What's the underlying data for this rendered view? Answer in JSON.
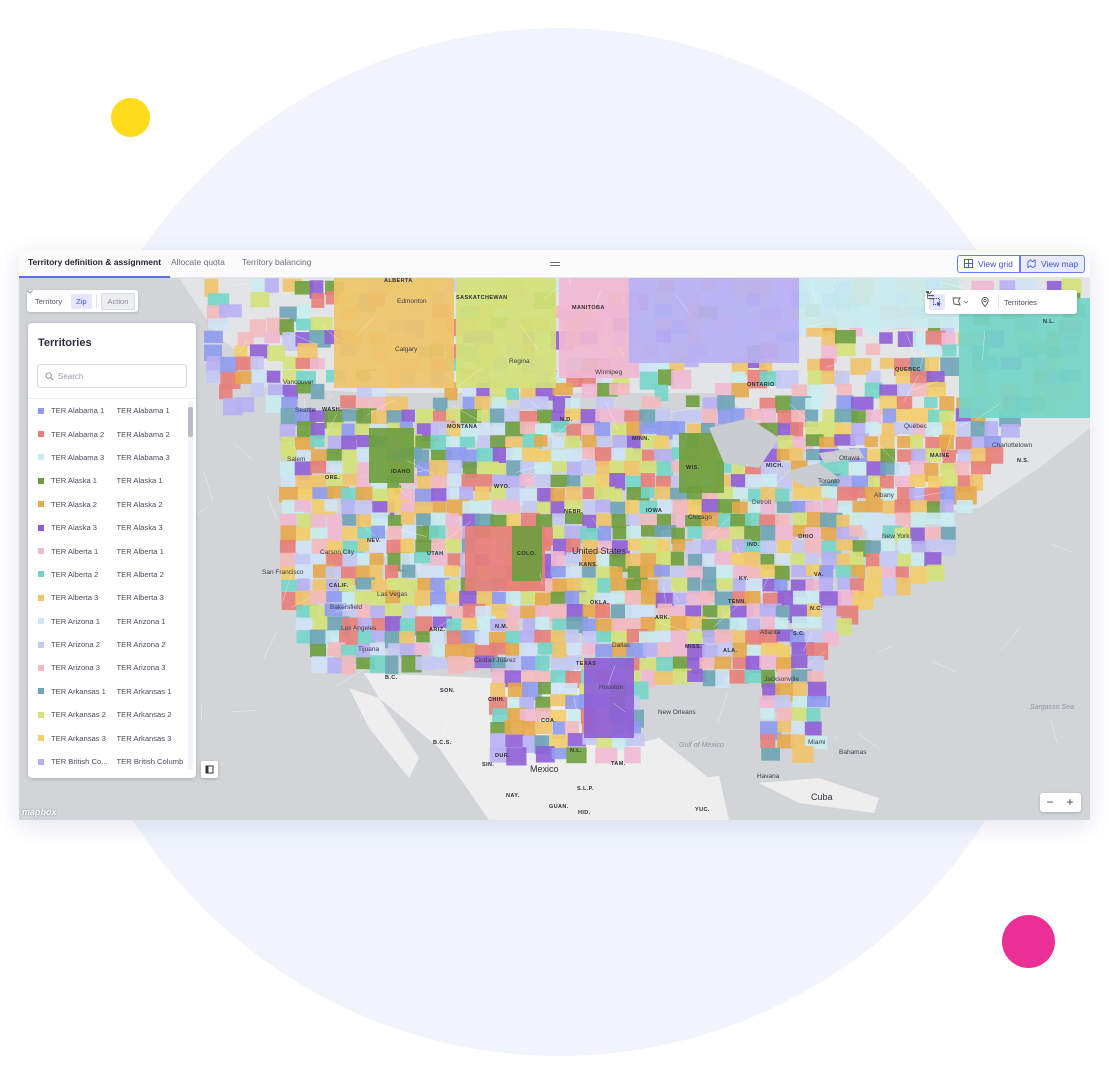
{
  "tabs": [
    {
      "label": "Territory definition & assignment",
      "active": true
    },
    {
      "label": "Allocate quota",
      "active": false
    },
    {
      "label": "Territory balancing",
      "active": false
    }
  ],
  "view_buttons": {
    "grid": "View grid",
    "map": "View map"
  },
  "mode": {
    "territory": "Territory",
    "zip": "Zip",
    "action": "Action",
    "active": "Zip"
  },
  "panel": {
    "title": "Territories",
    "search_placeholder": "Search"
  },
  "territories": [
    {
      "name": "TER Alabama 1",
      "label": "TER Alabama 1",
      "color": "#8e9bf0"
    },
    {
      "name": "TER Alabama 2",
      "label": "TER Alabama 2",
      "color": "#e77f7a"
    },
    {
      "name": "TER Alabama 3",
      "label": "TER Alabama 3",
      "color": "#c9ecf0"
    },
    {
      "name": "TER Alaska 1",
      "label": "TER Alaska 1",
      "color": "#6f9e3f"
    },
    {
      "name": "TER Alaska 2",
      "label": "TER Alaska 2",
      "color": "#e6a84b"
    },
    {
      "name": "TER Alaska 3",
      "label": "TER Alaska 3",
      "color": "#8f5fd6"
    },
    {
      "name": "TER Alberta 1",
      "label": "TER Alberta 1",
      "color": "#f0b9d3"
    },
    {
      "name": "TER Alberta 2",
      "label": "TER Alberta 2",
      "color": "#74d5c8"
    },
    {
      "name": "TER Alberta 3",
      "label": "TER Alberta 3",
      "color": "#efc46a"
    },
    {
      "name": "TER Arizona 1",
      "label": "TER Arizona 1",
      "color": "#cfe3f6"
    },
    {
      "name": "TER Arizona 2",
      "label": "TER Arizona 2",
      "color": "#c4c9f4"
    },
    {
      "name": "TER Arizona 3",
      "label": "TER Arizona 3",
      "color": "#f3b9be"
    },
    {
      "name": "TER Arkansas 1",
      "label": "TER Arkansas 1",
      "color": "#6ea4b6"
    },
    {
      "name": "TER Arkansas 2",
      "label": "TER Arkansas 2",
      "color": "#d4e27a"
    },
    {
      "name": "TER Arkansas 3",
      "label": "TER Arkansas 3",
      "color": "#f2cd6a"
    },
    {
      "name": "TER British Co...",
      "label": "TER British Columb",
      "color": "#b7b0f3"
    }
  ],
  "map_toolbar": {
    "layer": "Territories"
  },
  "map_labels": [
    {
      "t": "ALBERTA",
      "k": "caps"
    },
    {
      "t": "SASKATCHEWAN",
      "k": "caps"
    },
    {
      "t": "MANITOBA",
      "k": "caps"
    },
    {
      "t": "ONTARIO",
      "k": "caps"
    },
    {
      "t": "QUEBEC",
      "k": "caps"
    },
    {
      "t": "N.L.",
      "k": "caps"
    },
    {
      "t": "Edmonton",
      "k": ""
    },
    {
      "t": "Calgary",
      "k": ""
    },
    {
      "t": "Regina",
      "k": ""
    },
    {
      "t": "Winnipeg",
      "k": ""
    },
    {
      "t": "Vancouver",
      "k": ""
    },
    {
      "t": "Seattle",
      "k": ""
    },
    {
      "t": "WASH.",
      "k": "caps"
    },
    {
      "t": "MONTANA",
      "k": "caps"
    },
    {
      "t": "N.D.",
      "k": "caps"
    },
    {
      "t": "MINN.",
      "k": "caps"
    },
    {
      "t": "ORE.",
      "k": "caps"
    },
    {
      "t": "IDAHO",
      "k": "caps"
    },
    {
      "t": "WYO.",
      "k": "caps"
    },
    {
      "t": "NEBR.",
      "k": "caps"
    },
    {
      "t": "NEV.",
      "k": "caps"
    },
    {
      "t": "UTAH",
      "k": "caps"
    },
    {
      "t": "COLO.",
      "k": "caps"
    },
    {
      "t": "United States",
      "k": "big"
    },
    {
      "t": "KANS.",
      "k": "caps"
    },
    {
      "t": "San Francisco",
      "k": ""
    },
    {
      "t": "CALIF.",
      "k": "caps"
    },
    {
      "t": "Las Vegas",
      "k": ""
    },
    {
      "t": "Los Angeles",
      "k": ""
    },
    {
      "t": "ARIZ.",
      "k": "caps"
    },
    {
      "t": "N.M.",
      "k": "caps"
    },
    {
      "t": "OKLA.",
      "k": "caps"
    },
    {
      "t": "TEXAS",
      "k": "caps"
    },
    {
      "t": "Dallas",
      "k": ""
    },
    {
      "t": "Ciudad Juárez",
      "k": ""
    },
    {
      "t": "Tijuana",
      "k": ""
    },
    {
      "t": "Chicago",
      "k": ""
    },
    {
      "t": "Toronto",
      "k": ""
    },
    {
      "t": "Ottawa",
      "k": ""
    },
    {
      "t": "Québec",
      "k": ""
    },
    {
      "t": "MAINE",
      "k": "caps"
    },
    {
      "t": "New York",
      "k": ""
    },
    {
      "t": "OHIO",
      "k": "caps"
    },
    {
      "t": "IND.",
      "k": "caps"
    },
    {
      "t": "KY.",
      "k": "caps"
    },
    {
      "t": "TENN.",
      "k": "caps"
    },
    {
      "t": "N.C.",
      "k": "caps"
    },
    {
      "t": "ALA.",
      "k": "caps"
    },
    {
      "t": "MISS.",
      "k": "caps"
    },
    {
      "t": "Atlanta",
      "k": ""
    },
    {
      "t": "Jacksonville",
      "k": ""
    },
    {
      "t": "Miami",
      "k": ""
    },
    {
      "t": "Bahamas",
      "k": ""
    },
    {
      "t": "Havana",
      "k": ""
    },
    {
      "t": "Cuba",
      "k": "big"
    },
    {
      "t": "Mexico",
      "k": "big"
    },
    {
      "t": "Houston",
      "k": ""
    },
    {
      "t": "New Orleans",
      "k": ""
    },
    {
      "t": "B.C.",
      "k": "caps"
    },
    {
      "t": "SON.",
      "k": "caps"
    },
    {
      "t": "CHIH.",
      "k": "caps"
    },
    {
      "t": "COA.",
      "k": "caps"
    },
    {
      "t": "B.C.S.",
      "k": "caps"
    },
    {
      "t": "DUR.",
      "k": "caps"
    },
    {
      "t": "N.L.",
      "k": "caps"
    },
    {
      "t": "TAM.",
      "k": "caps"
    },
    {
      "t": "SIN.",
      "k": "caps"
    },
    {
      "t": "S.L.P.",
      "k": "caps"
    },
    {
      "t": "NAY.",
      "k": "caps"
    },
    {
      "t": "GUAN.",
      "k": "caps"
    },
    {
      "t": "HID.",
      "k": "caps"
    },
    {
      "t": "YUC.",
      "k": "caps"
    },
    {
      "t": "Gulf of Mexico",
      "k": "water"
    },
    {
      "t": "Sargasso Sea",
      "k": "water"
    },
    {
      "t": "Charlottetown",
      "k": ""
    },
    {
      "t": "N.S.",
      "k": "caps"
    },
    {
      "t": "Detroit",
      "k": ""
    },
    {
      "t": "Albany",
      "k": ""
    },
    {
      "t": "MICH.",
      "k": "caps"
    },
    {
      "t": "WIS.",
      "k": "caps"
    },
    {
      "t": "IOWA",
      "k": "caps"
    },
    {
      "t": "ARK.",
      "k": "caps"
    },
    {
      "t": "S.C.",
      "k": "caps"
    },
    {
      "t": "VA.",
      "k": "caps"
    },
    {
      "t": "Carson City",
      "k": ""
    },
    {
      "t": "Bakersfield",
      "k": ""
    },
    {
      "t": "Salem",
      "k": ""
    }
  ],
  "map_logo": "mapbox",
  "zoom": {
    "out": "−",
    "in": "+"
  }
}
